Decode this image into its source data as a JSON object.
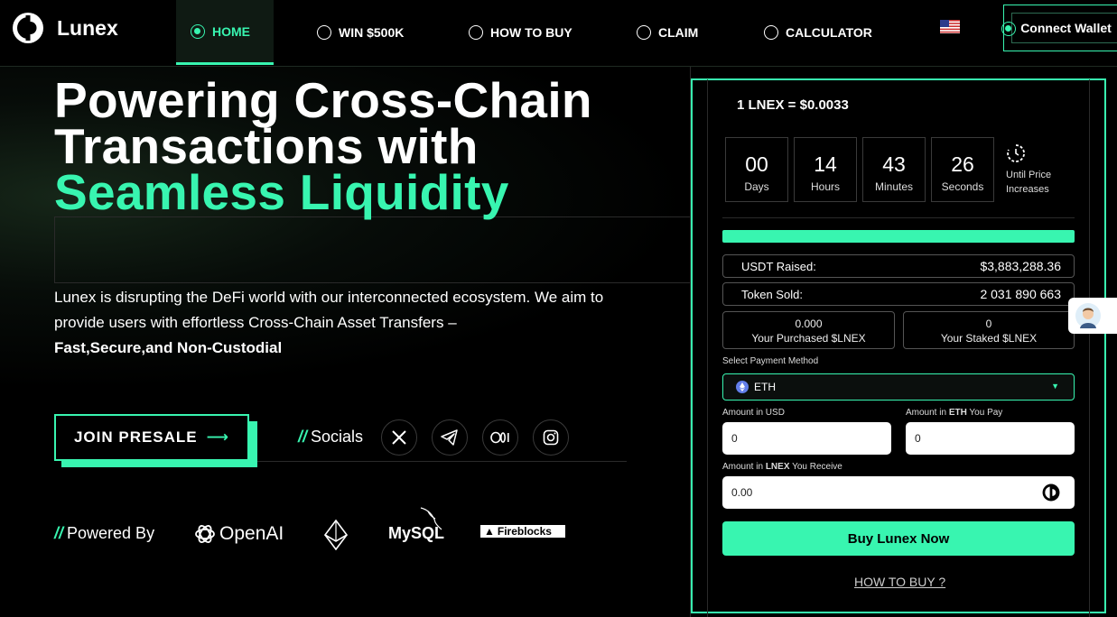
{
  "brand": {
    "name": "Lunex"
  },
  "nav": {
    "items": [
      {
        "label": "HOME",
        "active": true
      },
      {
        "label": "WIN $500K",
        "active": false
      },
      {
        "label": "HOW TO BUY",
        "active": false
      },
      {
        "label": "CLAIM",
        "active": false
      },
      {
        "label": "CALCULATOR",
        "active": false
      }
    ],
    "language_icon": "us-flag-icon",
    "connect_wallet": "Connect Wallet"
  },
  "hero": {
    "title_line1": "Powering Cross-Chain",
    "title_line2": "Transactions with",
    "title_line3": "Seamless Liquidity",
    "description": "Lunex is disrupting the DeFi world with our interconnected ecosystem. We aim to provide users with effortless Cross-Chain Asset Transfers –",
    "description_bold": "Fast,Secure,and Non-Custodial",
    "join_button": "JOIN PRESALE",
    "socials_label": "Socials",
    "socials": [
      "x-icon",
      "telegram-icon",
      "medium-icon",
      "instagram-icon"
    ],
    "powered_label": "Powered By",
    "partners": [
      "OpenAI",
      "MySQL",
      "Fireblocks"
    ]
  },
  "presale": {
    "price": "1 LNEX = $0.0033",
    "countdown": [
      {
        "value": "00",
        "label": "Days"
      },
      {
        "value": "14",
        "label": "Hours"
      },
      {
        "value": "43",
        "label": "Minutes"
      },
      {
        "value": "26",
        "label": "Seconds"
      }
    ],
    "until_line1": "Until Price",
    "until_line2": "Increases",
    "usdt_raised_label": "USDT Raised:",
    "usdt_raised_value": "$3,883,288.36",
    "token_sold_label": "Token Sold:",
    "token_sold_value": "2 031 890 663",
    "purchased_value": "0.000",
    "purchased_label": "Your Purchased $LNEX",
    "staked_value": "0",
    "staked_label": "Your Staked $LNEX",
    "payment_label": "Select Payment Method",
    "payment_selected": "ETH",
    "usd_label": "Amount in USD",
    "usd_value": "0",
    "eth_label_pre": "Amount in ",
    "eth_label_bold": "ETH",
    "eth_label_post": " You Pay",
    "eth_value": "0",
    "lnex_label_pre": "Amount in ",
    "lnex_label_bold": "LNEX",
    "lnex_label_post": " You Receive",
    "lnex_value": "0.00",
    "buy_button": "Buy Lunex Now",
    "how_to_buy_link": "HOW TO BUY ?"
  },
  "colors": {
    "accent": "#38f5b0",
    "background": "#000000"
  }
}
